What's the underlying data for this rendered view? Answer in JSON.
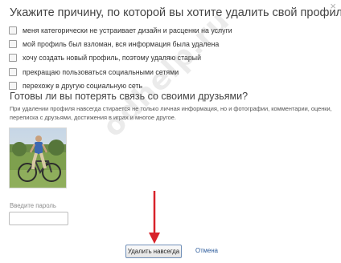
{
  "dialog": {
    "title": "Укажите причину, по которой вы хотите удалить свой профиль",
    "close_glyph": "×",
    "reasons": [
      "меня категорически не устраивает дизайн и расценки на услуги",
      "мой профиль был взломан, вся информация была удалена",
      "хочу создать новый профиль, поэтому удаляю старый",
      "прекращаю пользоваться социальными сетями",
      "перехожу в другую социальную сеть"
    ],
    "subtitle": "Готовы ли вы потерять связь со своими друзьями?",
    "description": "При удалении профиля навсегда стирается не только личная информация, но и фотографии, комментарии, оценки, переписка с друзьями, достижения в играх и многое другое.",
    "password_label": "Введите пароль",
    "password_value": "",
    "delete_button": "Удалить навсегда",
    "cancel_link": "Отмена"
  },
  "watermark": "odhelp.ru",
  "colors": {
    "title_text": "#444444",
    "link": "#2a5a9a",
    "button_border": "#6f8fb8",
    "arrow": "#d8222a"
  },
  "icons": {
    "close": "close-icon",
    "checkbox": "checkbox-icon",
    "arrow": "arrow-down-icon"
  }
}
